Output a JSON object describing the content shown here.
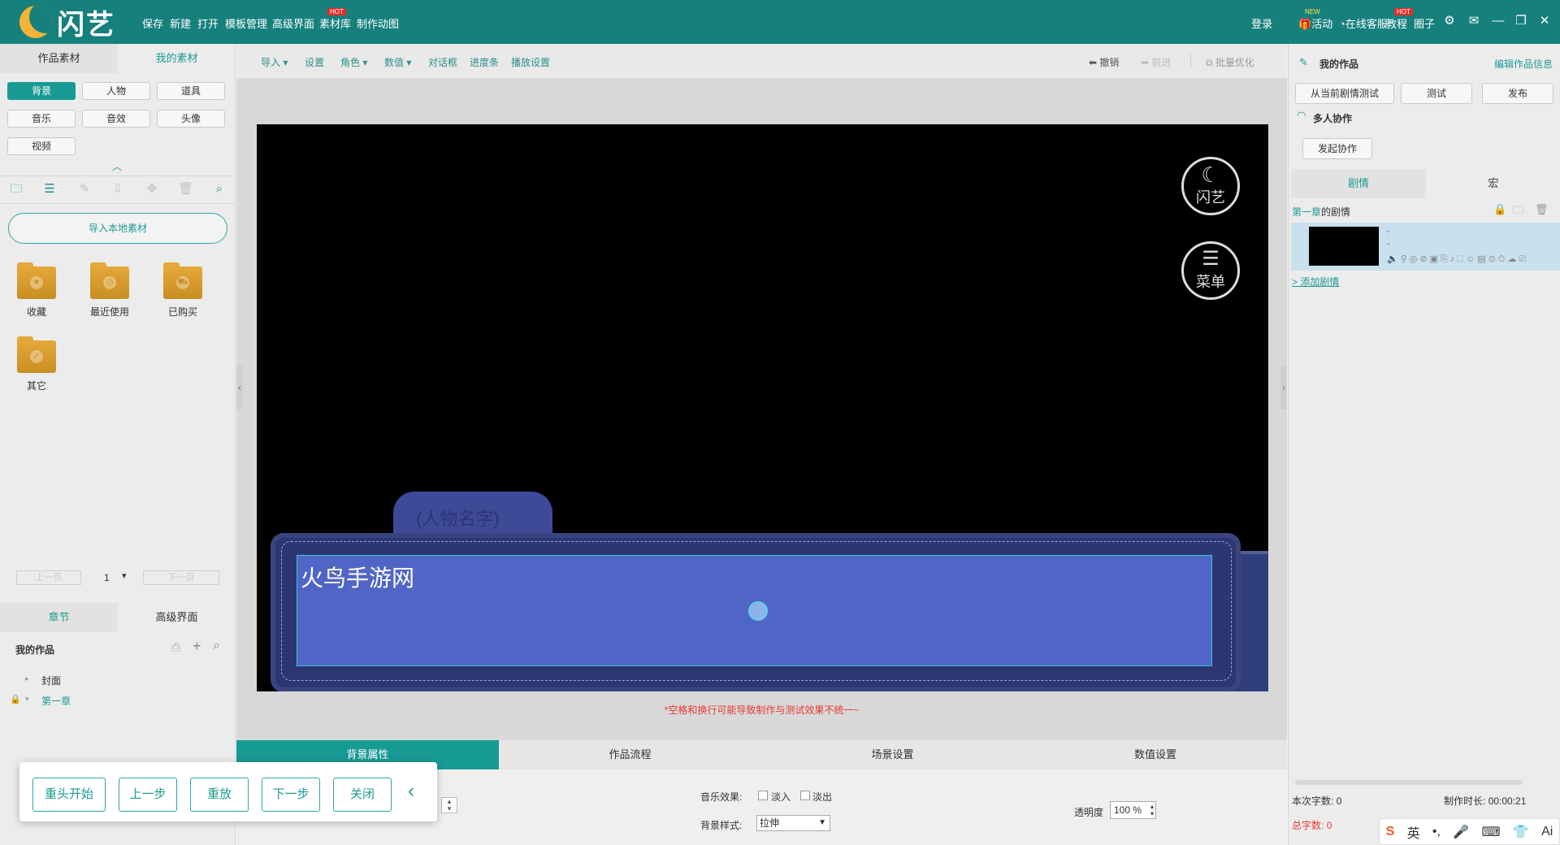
{
  "app": {
    "name": "闪艺",
    "brand_color": "#16807c",
    "accent": "#189a94"
  },
  "topbar": {
    "menu": [
      {
        "label": "保存"
      },
      {
        "label": "新建"
      },
      {
        "label": "打开"
      },
      {
        "label": "模板管理"
      },
      {
        "label": "高级界面"
      },
      {
        "label": "素材库",
        "badge": "HOT"
      },
      {
        "label": "制作动图"
      }
    ],
    "login": "登录",
    "right": [
      {
        "label": "活动",
        "badge": "NEW",
        "icon": "gift-icon"
      },
      {
        "label": "在线客服",
        "icon": "headset-icon"
      },
      {
        "label": "教程",
        "badge": "HOT"
      },
      {
        "label": "圈子"
      }
    ],
    "window_icons": [
      "gear-icon",
      "mail-icon",
      "minimize-icon",
      "restore-icon",
      "close-icon"
    ]
  },
  "left": {
    "tabs": [
      "作品素材",
      "我的素材"
    ],
    "categories": [
      "背景",
      "人物",
      "道具",
      "音乐",
      "音效",
      "头像",
      "视频"
    ],
    "active_category": "背景",
    "import_button": "导入本地素材",
    "folders": [
      "收藏",
      "最近使用",
      "已购买",
      "其它"
    ],
    "pager": {
      "prev": "上一页",
      "page": "1",
      "next": "下一页"
    },
    "bottom_tabs": [
      "章节",
      "高级界面"
    ],
    "tree_title": "我的作品",
    "tree": [
      {
        "label": "封面"
      },
      {
        "label": "第一章"
      }
    ]
  },
  "center": {
    "toolbar": [
      {
        "label": "导入",
        "dropdown": true
      },
      {
        "label": "设置"
      },
      {
        "label": "角色",
        "dropdown": true
      },
      {
        "label": "数值",
        "dropdown": true
      },
      {
        "label": "对话框"
      },
      {
        "label": "进度条"
      },
      {
        "label": "播放设置"
      }
    ],
    "undo": "撤销",
    "redo": "前进",
    "batch": "批量优化",
    "stage": {
      "logo_label": "闪艺",
      "menu_label": "菜单",
      "dialog_name_placeholder": "(人物名字)",
      "dialog_text": "火鸟手游网"
    },
    "warning": "*空格和换行可能导致制作与测试效果不统一~",
    "bottom_tabs": [
      "背景属性",
      "作品流程",
      "场景设置",
      "数值设置"
    ],
    "active_bottom_tab": "背景属性",
    "props": {
      "music_effect_label": "音乐效果:",
      "fade_in": "淡入",
      "fade_out": "淡出",
      "bg_style_label": "背景样式:",
      "bg_style_value": "拉伸",
      "opacity_label": "透明度",
      "opacity_value": "100 %"
    }
  },
  "right": {
    "title": "我的作品",
    "edit_info": "编辑作品信息",
    "buttons": [
      "从当前剧情测试",
      "测试",
      "发布"
    ],
    "collab_title": "多人协作",
    "collab_button": "发起协作",
    "tabs": [
      "剧情",
      "宏"
    ],
    "chapter_prefix": "第一章",
    "chapter_suffix": "的剧情",
    "scene_dash1": "-",
    "scene_dash2": "-",
    "add_plot": "> 添加剧情",
    "word_count_label": "本次字数:",
    "word_count": "0",
    "duration_label": "制作时长:",
    "duration": "00:00:21",
    "total_label": "总字数:",
    "total": "0"
  },
  "overlay": {
    "buttons": [
      "重头开始",
      "上一步",
      "重放",
      "下一步",
      "关闭"
    ]
  },
  "ime": {
    "labels": [
      "英",
      "Ai"
    ]
  }
}
